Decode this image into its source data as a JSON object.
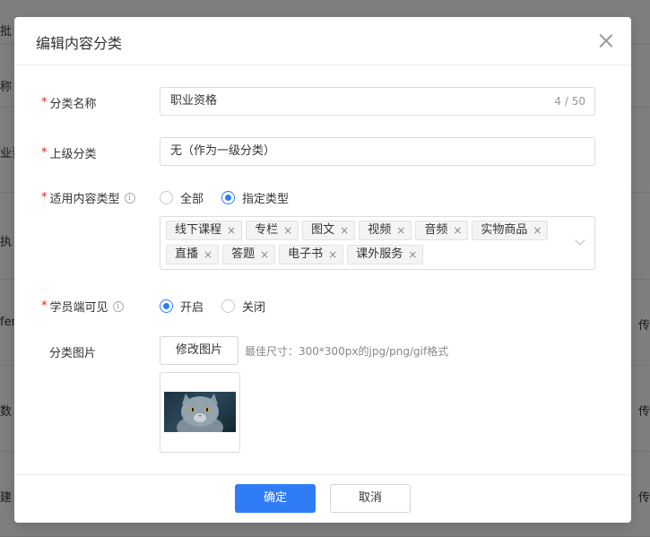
{
  "background": {
    "top_left_text": "批",
    "rows": [
      "称",
      "业资",
      "执",
      "fen",
      "数",
      "建"
    ],
    "right_cells": [
      "传",
      "传",
      "传"
    ]
  },
  "dialog": {
    "title": "编辑内容分类",
    "fields": {
      "name": {
        "label": "分类名称",
        "required": true,
        "value": "职业资格",
        "counter": "4 / 50"
      },
      "parent": {
        "label": "上级分类",
        "required": true,
        "value": "无（作为一级分类）"
      },
      "content_types": {
        "label": "适用内容类型",
        "required": true,
        "info_icon": "i",
        "options": [
          "全部",
          "指定类型"
        ],
        "selected": "指定类型",
        "tags": [
          "线下课程",
          "专栏",
          "图文",
          "视频",
          "音频",
          "实物商品",
          "直播",
          "答题",
          "电子书",
          "课外服务"
        ],
        "tag_remove_glyph": "×"
      },
      "student_visible": {
        "label": "学员端可见",
        "required": true,
        "info_icon": "i",
        "options": [
          "开启",
          "关闭"
        ],
        "selected": "开启"
      },
      "image": {
        "label": "分类图片",
        "button_label": "修改图片",
        "hint": "最佳尺寸：300*300px的jpg/png/gif格式"
      }
    },
    "footer": {
      "confirm_label": "确定",
      "cancel_label": "取消"
    }
  },
  "colors": {
    "primary": "#2f7cf6",
    "required": "#e02020",
    "overlay": "rgba(0,0,0,0.5)"
  },
  "icons": {
    "close": "close-icon",
    "dropdown": "chevron-down-icon",
    "info": "info-icon",
    "tag_remove": "close-icon"
  }
}
